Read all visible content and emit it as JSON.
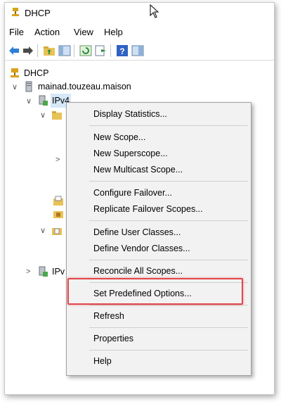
{
  "window": {
    "title": "DHCP"
  },
  "menubar": {
    "items": [
      "File",
      "Action",
      "View",
      "Help"
    ]
  },
  "tree": {
    "root": "DHCP",
    "server": "mainad.touzeau.maison",
    "ipv4": "IPv4",
    "ipv6_partial": "IPv"
  },
  "context_menu": {
    "items": [
      "Display Statistics...",
      "New Scope...",
      "New Superscope...",
      "New Multicast Scope...",
      "Configure Failover...",
      "Replicate Failover Scopes...",
      "Define User Classes...",
      "Define Vendor Classes...",
      "Reconcile All Scopes...",
      "Set Predefined Options...",
      "Refresh",
      "Properties",
      "Help"
    ],
    "highlighted": "Set Predefined Options..."
  },
  "colors": {
    "highlight_border": "#e0474c",
    "menu_bg": "#f2f2f2"
  }
}
